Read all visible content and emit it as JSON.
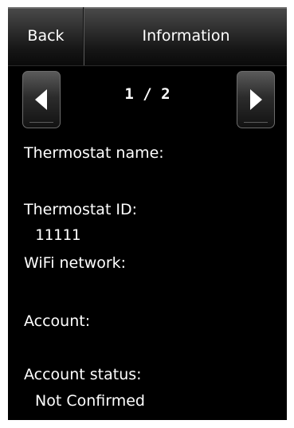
{
  "header": {
    "back_label": "Back",
    "title": "Information"
  },
  "pager": {
    "indicator": "1 / 2"
  },
  "fields": {
    "thermostat_name": {
      "label": "Thermostat name:",
      "value": ""
    },
    "thermostat_id": {
      "label": "Thermostat ID:",
      "value": "11111"
    },
    "wifi_network": {
      "label": "WiFi network:",
      "value": ""
    },
    "account": {
      "label": "Account:",
      "value": ""
    },
    "account_status": {
      "label": "Account status:",
      "value": "Not Confirmed"
    }
  },
  "icons": {
    "prev": "left-arrow-icon",
    "next": "right-arrow-icon"
  },
  "colors": {
    "background": "#000000",
    "text": "#ffffff"
  }
}
